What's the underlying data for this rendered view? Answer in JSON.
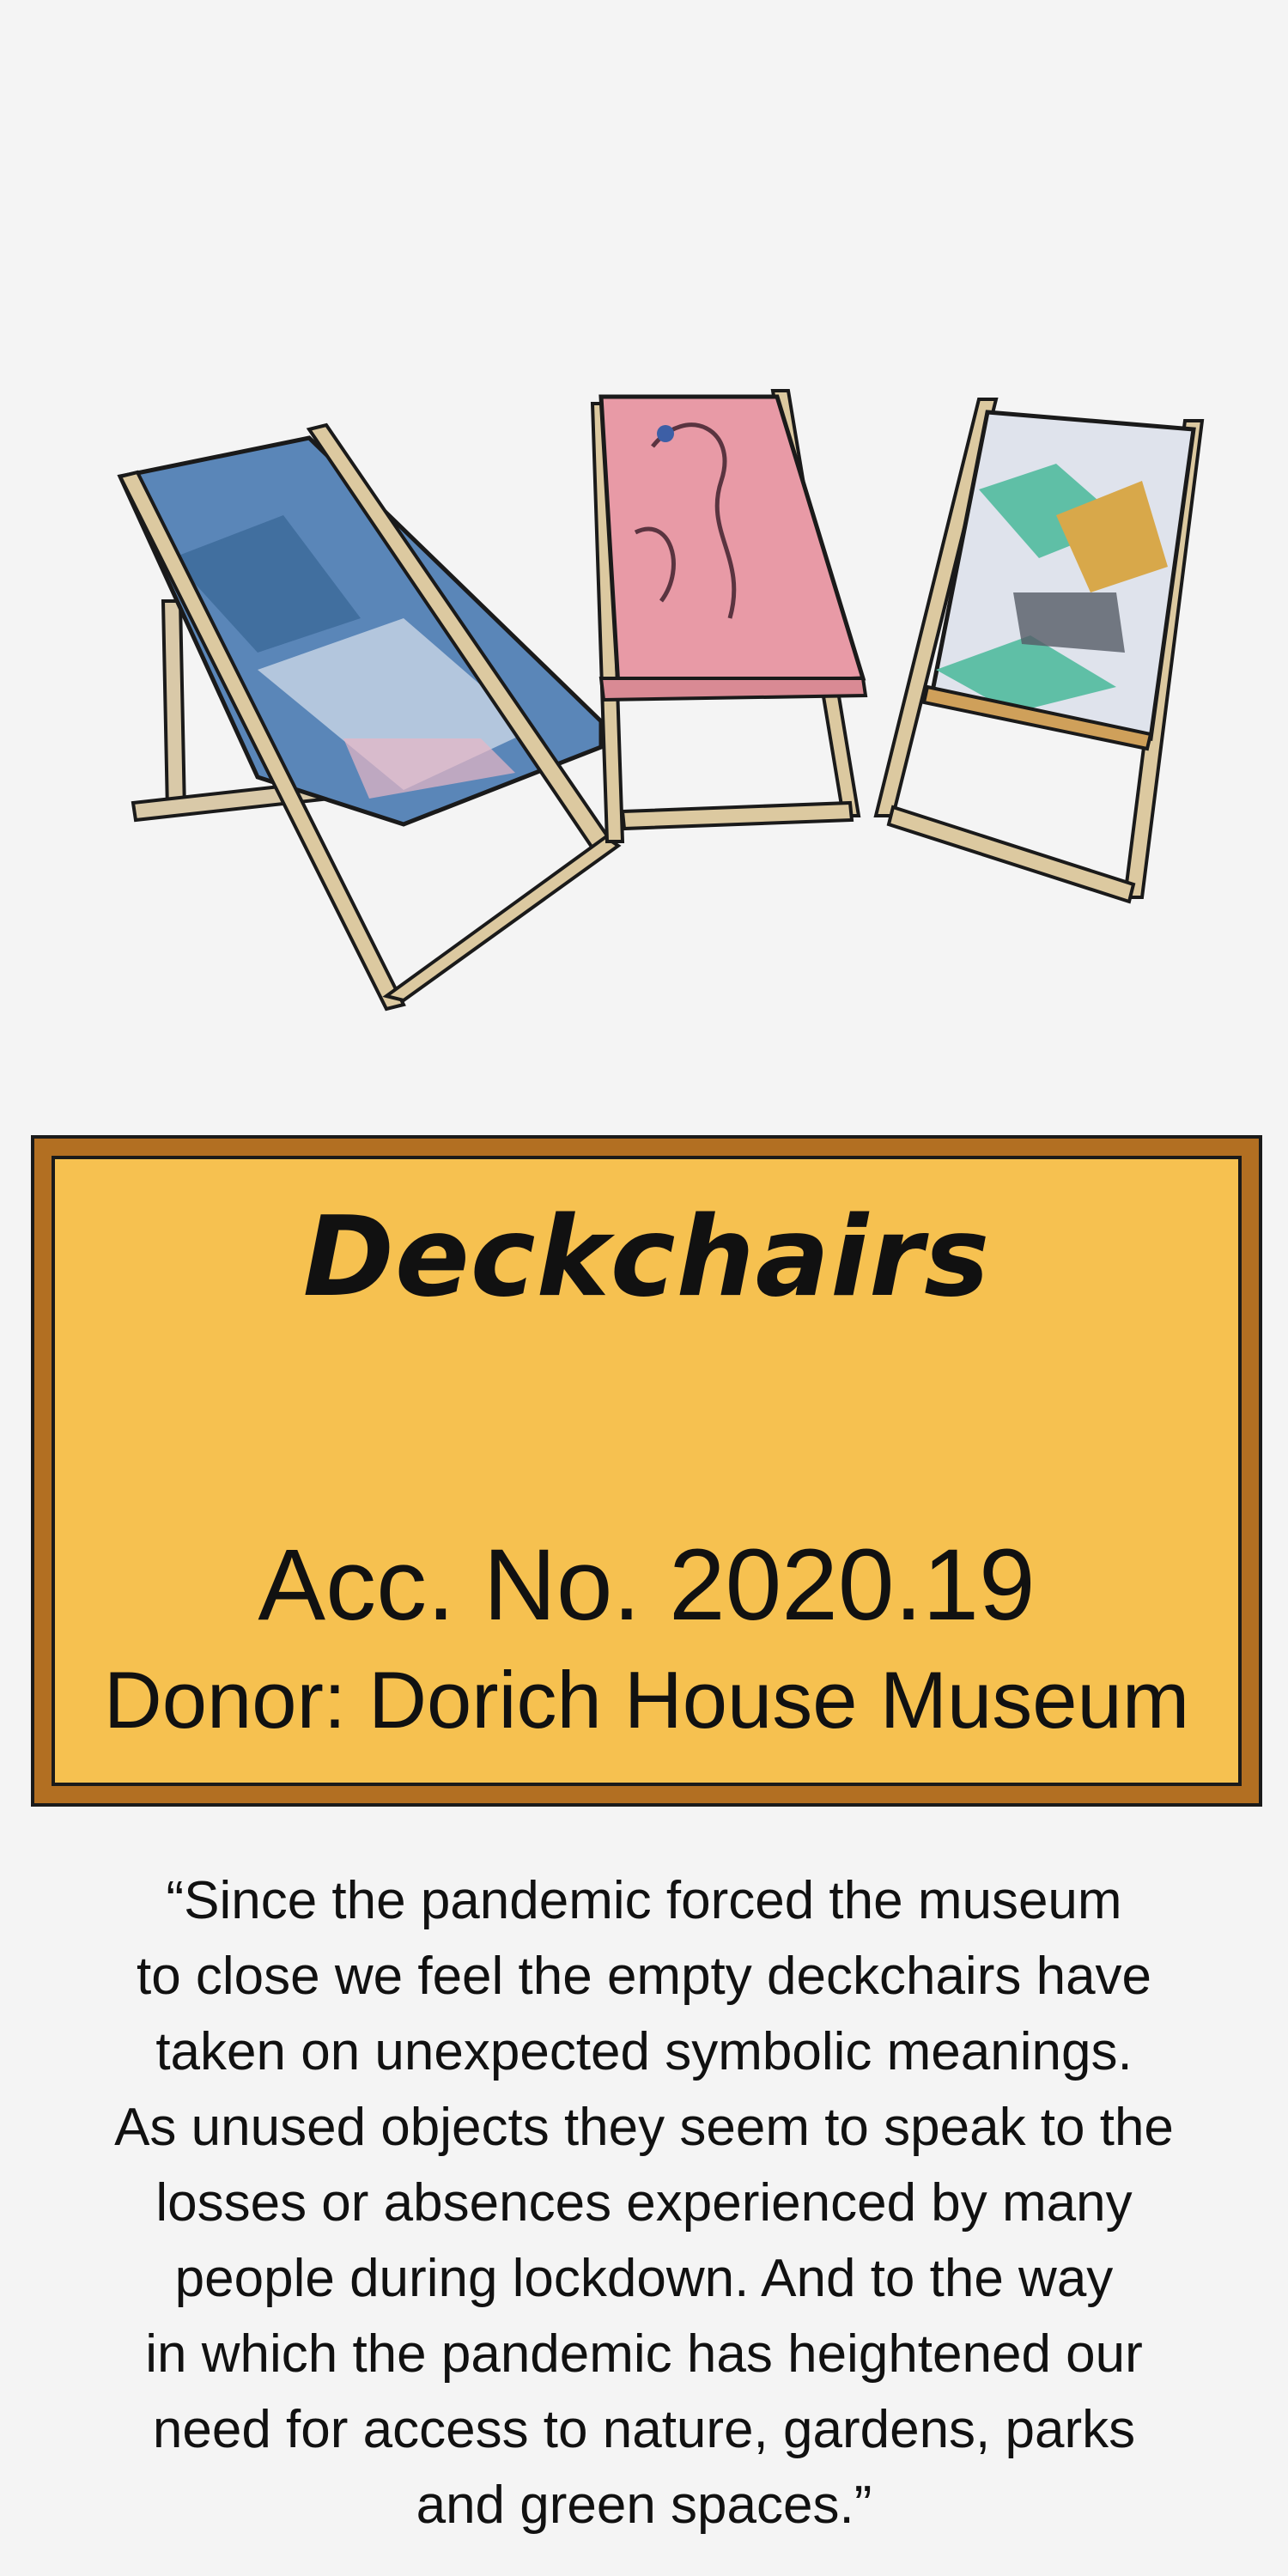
{
  "label": {
    "title": "Deckchairs",
    "acc_no": "Acc. No. 2020.19",
    "donor": "Donor: Dorich House Museum"
  },
  "quote": {
    "lines": [
      "“Since the pandemic forced the museum",
      "to close we feel the empty deckchairs have",
      "taken on unexpected symbolic meanings.",
      "As unused objects they seem to speak to the",
      "losses or absences experienced by many",
      "people during lockdown. And to the way",
      "in which the pandemic has heightened our",
      "need for access to nature, gardens, parks",
      "and green spaces.”"
    ]
  },
  "colors": {
    "background": "#f4f4f4",
    "label_frame": "#b26f22",
    "label_panel": "#f6c150",
    "chair_blue": "#5a86b8",
    "chair_pink": "#e89aa6",
    "chair_teal": "#5fbfa6"
  }
}
